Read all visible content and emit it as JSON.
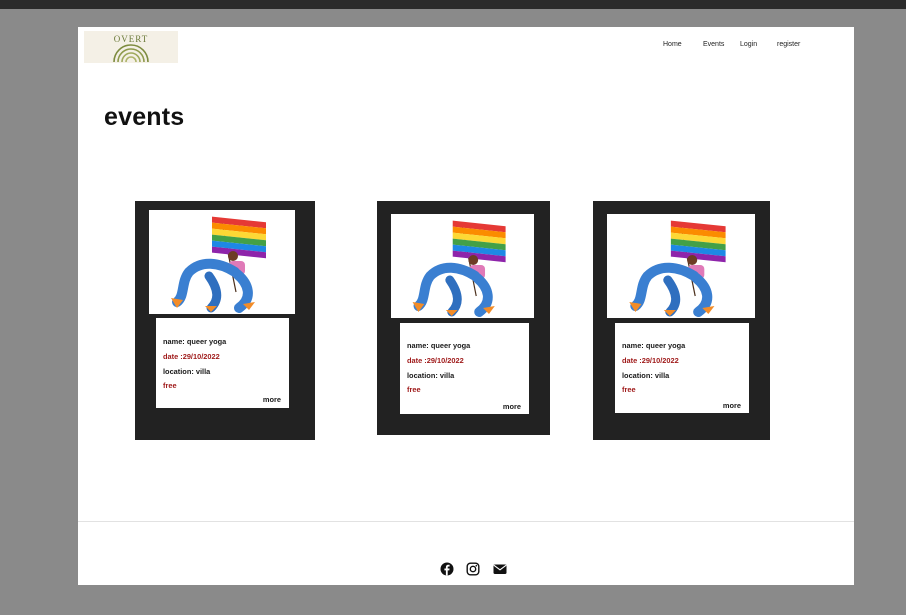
{
  "header": {
    "logo_text": "OVERT",
    "nav": [
      {
        "label": "Home"
      },
      {
        "label": "Events"
      },
      {
        "label": "Login"
      },
      {
        "label": "register"
      }
    ]
  },
  "main": {
    "title": "events",
    "cards": [
      {
        "name": "name:  queer yoga",
        "date": "date :29/10/2022",
        "location": "location: villa",
        "price": "free",
        "more": "more"
      },
      {
        "name": "name:  queer yoga",
        "date": "date :29/10/2022",
        "location": "location: villa",
        "price": "free",
        "more": "more"
      },
      {
        "name": "name:  queer yoga",
        "date": "date :29/10/2022",
        "location": "location: villa",
        "price": "free",
        "more": "more"
      }
    ]
  },
  "footer": {
    "social_icons": [
      "facebook-icon",
      "instagram-icon",
      "envelope-icon"
    ]
  },
  "colors": {
    "background": "#8a8a8a",
    "page": "#ffffff",
    "card": "#222222",
    "accent_red": "#a01c1c"
  }
}
